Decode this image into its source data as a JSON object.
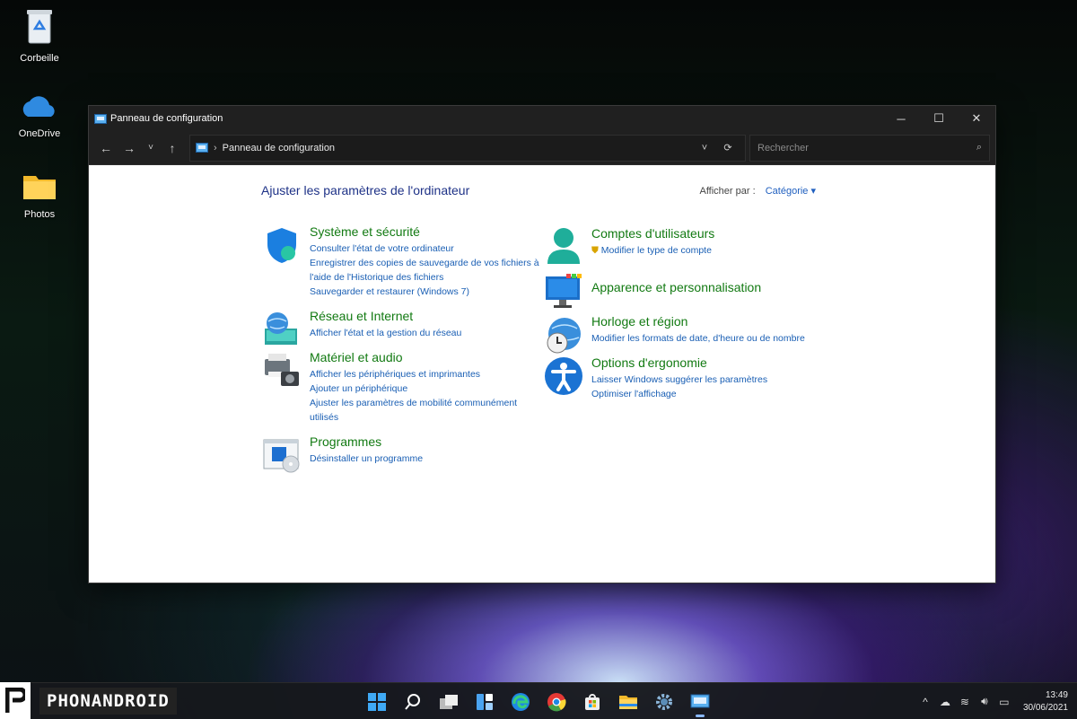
{
  "desktop": {
    "icons": [
      {
        "label": "Corbeille",
        "icon": "recycle-bin-icon"
      },
      {
        "label": "OneDrive",
        "icon": "onedrive-cloud-icon"
      },
      {
        "label": "Photos",
        "icon": "folder-icon"
      }
    ]
  },
  "window": {
    "title": "Panneau de configuration",
    "controls": {
      "minimize": "─",
      "maximize": "☐",
      "close": "✕"
    },
    "nav": {
      "back": "←",
      "forward": "→",
      "recent": "˅",
      "up": "↑"
    },
    "address": {
      "sep": "›",
      "path": "Panneau de configuration",
      "dropdown": "˅",
      "refresh": "⟳"
    },
    "search": {
      "placeholder": "Rechercher",
      "icon": "⌕"
    }
  },
  "content": {
    "heading": "Ajuster les paramètres de l'ordinateur",
    "view_by": {
      "label": "Afficher par :",
      "value": "Catégorie ▾"
    },
    "categories_left": [
      {
        "title": "Système et sécurité",
        "icon": "shield-icon",
        "links": [
          "Consulter l'état de votre ordinateur",
          "Enregistrer des copies de sauvegarde de vos fichiers à",
          "l'aide de l'Historique des fichiers",
          "Sauvegarder et restaurer (Windows 7)"
        ]
      },
      {
        "title": "Réseau et Internet",
        "icon": "network-globe-icon",
        "links": [
          "Afficher l'état et la gestion du réseau"
        ]
      },
      {
        "title": "Matériel et audio",
        "icon": "printer-camera-icon",
        "links": [
          "Afficher les périphériques et imprimantes",
          "Ajouter un périphérique",
          "Ajuster les paramètres de mobilité communément",
          "utilisés"
        ]
      },
      {
        "title": "Programmes",
        "icon": "programs-icon",
        "links": [
          "Désinstaller un programme"
        ]
      }
    ],
    "categories_right": [
      {
        "title": "Comptes d'utilisateurs",
        "icon": "user-accounts-icon",
        "links": [
          "Modifier le type de compte"
        ]
      },
      {
        "title": "Apparence et personnalisation",
        "icon": "monitor-palette-icon",
        "links": []
      },
      {
        "title": "Horloge et région",
        "icon": "clock-globe-icon",
        "links": [
          "Modifier les formats de date, d'heure ou de nombre"
        ]
      },
      {
        "title": "Options d'ergonomie",
        "icon": "accessibility-icon",
        "links": [
          "Laisser Windows suggérer les paramètres",
          "Optimiser l'affichage"
        ]
      }
    ]
  },
  "taskbar": {
    "brand": "PHONANDROID",
    "apps": [
      "start-icon",
      "search-icon",
      "task-view-icon",
      "widgets-icon",
      "edge-icon",
      "chrome-icon",
      "store-icon",
      "file-explorer-icon",
      "settings-icon",
      "control-panel-icon"
    ],
    "tray": {
      "chevron": "^",
      "time": "13:49",
      "date": "30/06/2021"
    }
  }
}
